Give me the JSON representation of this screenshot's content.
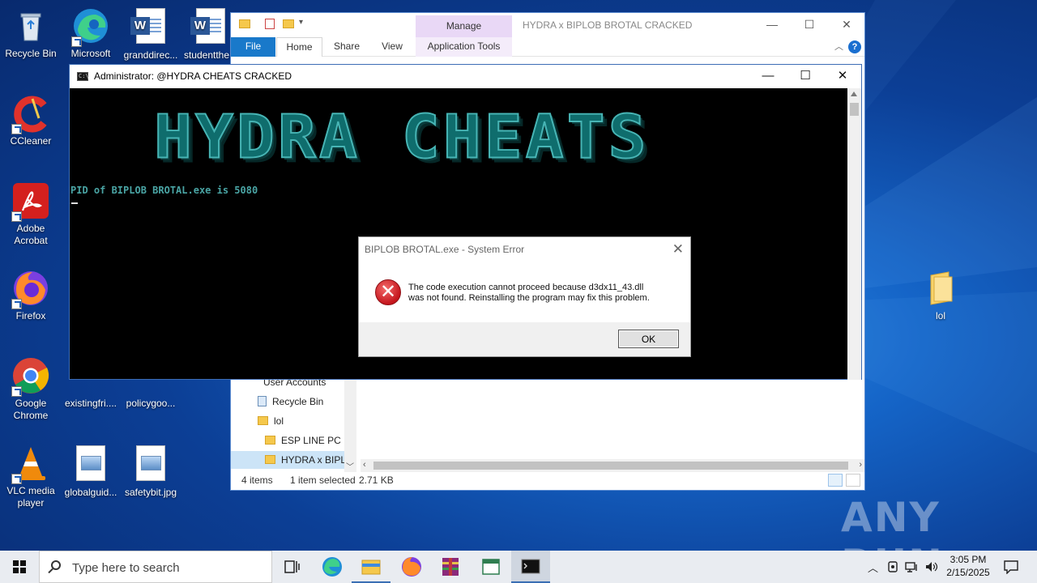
{
  "desktop": {
    "icons": [
      {
        "label": "Recycle Bin"
      },
      {
        "label": "Microsoft Edge"
      },
      {
        "label": "granddirec..."
      },
      {
        "label": "studentthe..."
      },
      {
        "label": "CCleaner"
      },
      {
        "label": "Adobe Acrobat"
      },
      {
        "label": "Firefox"
      },
      {
        "label": "Google Chrome"
      },
      {
        "label": "existingfri...."
      },
      {
        "label": "policygoo..."
      },
      {
        "label": "VLC media player"
      },
      {
        "label": "globalguid..."
      },
      {
        "label": "safetybit.jpg"
      },
      {
        "label": "lol"
      }
    ]
  },
  "explorer": {
    "title": "HYDRA x BIPLOB BROTAL CRACKED",
    "manage_tab": "Manage",
    "tabs": {
      "file": "File",
      "home": "Home",
      "share": "Share",
      "view": "View",
      "app_tools": "Application Tools"
    },
    "nav": [
      {
        "label": "User Accounts"
      },
      {
        "label": "Recycle Bin"
      },
      {
        "label": "lol"
      },
      {
        "label": "ESP LINE PC BI"
      },
      {
        "label": "HYDRA x BIPLO"
      }
    ],
    "status": {
      "items": "4 items",
      "selected": "1 item selected",
      "size": "2.71 KB"
    }
  },
  "cmd": {
    "title": "Administrator:  @HYDRA CHEATS CRACKED",
    "banner": "HYDRA CHEATS",
    "line": "PID of BIPLOB BROTAL.exe is 5080"
  },
  "dialog": {
    "title": "BIPLOB BROTAL.exe - System Error",
    "message_1": "The code execution cannot proceed because d3dx11_43.dll",
    "message_2": "was not found. Reinstalling the program may fix this problem.",
    "ok": "OK"
  },
  "watermark": "ANY RUN",
  "taskbar": {
    "search_placeholder": "Type here to search",
    "time": "3:05 PM",
    "date": "2/15/2025"
  },
  "colors": {
    "accent": "#1979ca",
    "manage": "#e9d8f6",
    "banner": "#47b5b5",
    "error": "#c5161d"
  }
}
